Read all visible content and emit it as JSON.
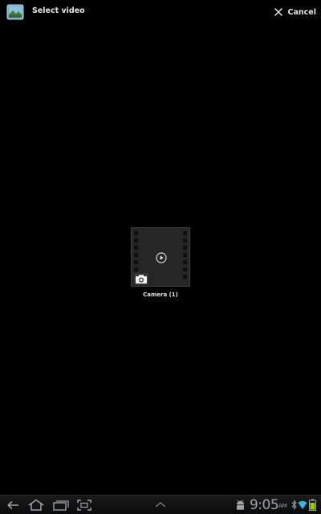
{
  "action_bar": {
    "title": "Select video",
    "cancel_label": "Cancel",
    "app_icon": "gallery-icon",
    "close_icon": "close-icon"
  },
  "album": {
    "label": "Camera (1)",
    "thumbnail_icon": "play-icon",
    "badge_icon": "camera-icon"
  },
  "system_bar": {
    "time": "9:05",
    "ampm": "AM",
    "nav_icons": [
      "back-icon",
      "home-icon",
      "recent-apps-icon",
      "screenshot-icon"
    ],
    "center_icon": "chevron-up-icon",
    "status_icons": [
      "android-debug-icon",
      "bluetooth-icon",
      "wifi-icon",
      "battery-icon"
    ]
  },
  "colors": {
    "background": "#000000",
    "text": "#e6e6e6",
    "system_icons": "#9ea3a8",
    "wifi_accent": "#33b5e5",
    "battery_accent": "#99cc00"
  }
}
